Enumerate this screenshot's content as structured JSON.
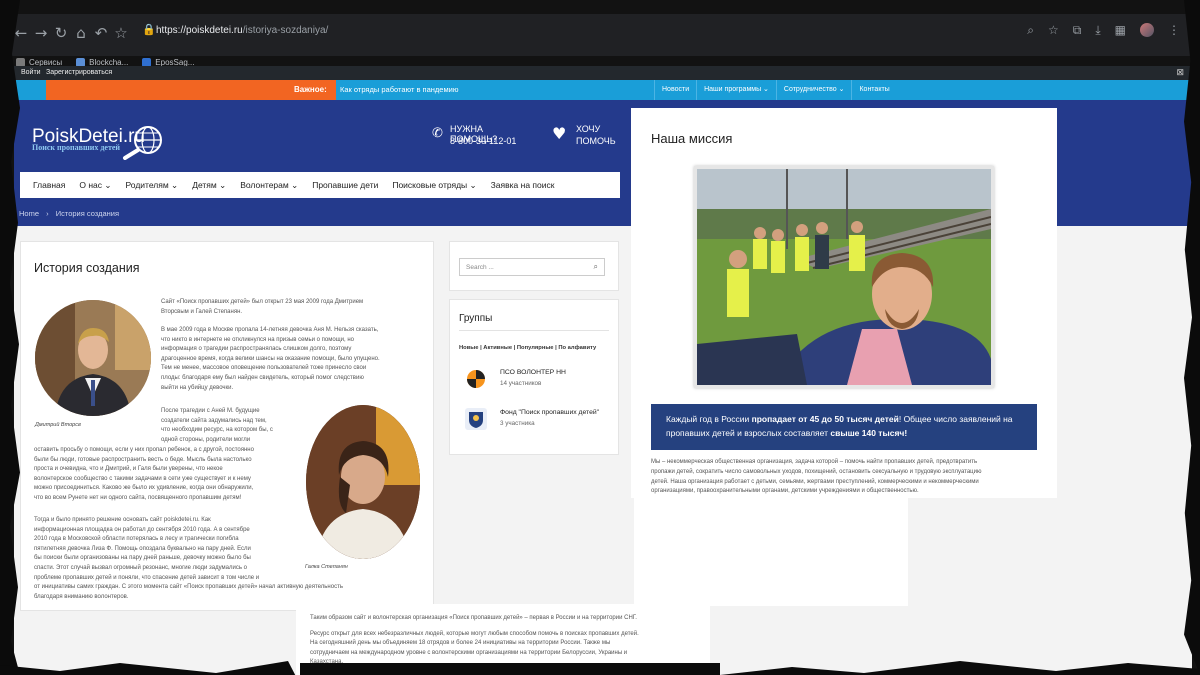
{
  "browser": {
    "url_host": "https://poiskdetei.ru",
    "url_path": "/istoriya-sozdaniya/",
    "bookmarks": [
      "Сервисы",
      "Blockcha...",
      "EposSag..."
    ]
  },
  "wpbar": {
    "login": "Войти",
    "register": "Зарегистрироваться"
  },
  "topstrip": {
    "important_label": "Важное:",
    "ticker": "Как отряды работают в пандемию",
    "menu": [
      "Новости",
      "Наши программы ⌄",
      "Сотрудничество ⌄",
      "Контакты"
    ]
  },
  "header": {
    "logo_text": "PoiskDetei.ru",
    "logo_sub": "Поиск пропавших детей",
    "help_title": "НУЖНА ПОМОЩЬ?",
    "help_phone": "8-800-30-112-01",
    "want_line1": "ХОЧУ",
    "want_line2": "ПОМОЧЬ",
    "main_menu": [
      "Главная",
      "О нас ⌄",
      "Родителям ⌄",
      "Детям ⌄",
      "Волонтерам ⌄",
      "Пропавшие дети",
      "Поисковые отряды ⌄",
      "Заявка на поиск"
    ],
    "breadcrumb_home": "Home",
    "breadcrumb_sep": "›",
    "breadcrumb_current": "История создания"
  },
  "article": {
    "title": "История создания",
    "caption1": "Дмитрий Вторсв",
    "caption2": "Галка Степанян",
    "p1_lines": [
      "Сайт «Поиск пропавших детей» был открыт 23 мая 2009 года Дмитрием",
      "Вторсвым и Галей Степанян."
    ],
    "p2_lines": [
      "В мае 2009 года в Москве пропала 14-летняя девочка Аня М. Нельзя сказать,",
      "что никто в интернете не откликнулся на призыв семьи о помощи, но",
      "информация о трагедии распространялась слишком долго, поэтому",
      "драгоценное время, когда велики шансы на оказание помощи, было упущено.",
      "Тем не менее, массовое оповещение пользователей тоже принесло свои",
      "плоды: благодаря ему был найден свидетель, который помог следствию",
      "выйти на убийцу девочки."
    ],
    "p3_lines": [
      "После трагедии с Аней М. будущие",
      "создатели сайта задумались над тем,",
      "что необходим ресурс, на котором бы, с",
      "одной стороны, родители могли"
    ],
    "p4_lines": [
      "оставить просьбу о помощи, если у них пропал ребенок, а с другой, постоянно",
      "были бы люди, готовые распространить весть о беде. Мысль была настолько",
      "проста и очевидна, что и Дмитрий, и Галя были уверены, что некое",
      "волонтерское сообщество с такими задачами в сети уже существует и к нему",
      "можно присоединиться. Каково же было их удивление, когда они обнаружили,",
      "что во всем Рунете нет ни одного сайта, посвященного пропавшим детям!"
    ],
    "p5_lines": [
      "Тогда и было принято решение основать сайт poiskdetei.ru. Как",
      "информационная площадка он работал до сентября 2010 года. А в сентябре",
      "2010 года в Московской области потерялась в лесу и трагически погибла",
      "пятилетняя девочка Лиза Ф. Помощь опоздала буквально на пару дней. Если",
      "бы поиски были организованы на пару дней раньше, девочку можно было бы",
      "спасти. Этот случай вызвал огромный резонанс, многие люди задумались о",
      "проблеме пропавших детей и поняли, что спасение детей зависит в том числе и",
      "от инициативы самих граждан. С этого момента сайт «Поиск пропавших детей» начал активную деятельность",
      "благодаря вниманию волонтеров."
    ]
  },
  "lower": {
    "lines": [
      "Таким образом сайт и волонтерская организация «Поиск пропавших детей» – первая в России и на территории СНГ.",
      "",
      "Ресурс открыт для всех небезразличных людей, которые могут любым способом помочь в поисках пропавших детей.",
      "На сегодняшний день мы объединяем 18 отрядов и более 24 инициативы на территории России. Также мы",
      "сотрудничаем на международном уровне с волонтерскими организациями на территории Белоруссии, Украины и",
      "Казахстана."
    ]
  },
  "sidebar": {
    "search_placeholder": "Search ...",
    "groups_title": "Группы",
    "filters": "Новые | Активные | Популярные | По алфавиту",
    "groups": [
      {
        "name": "ПСО ВОЛОНТЕР НН",
        "count": "14 участников"
      },
      {
        "name": "Фонд \"Поиск пропавших детей\"",
        "count": "3 участника"
      }
    ]
  },
  "mission": {
    "title": "Наша миссия",
    "banner_pre": "Каждый год в России ",
    "banner_b1": "пропадает от 45 до 50 тысяч детей",
    "banner_mid": "! Общее число заявлений на пропавших детей и взрослых составляет ",
    "banner_b2": "свыше 140 тысяч!",
    "text_lines": [
      "Мы – некоммерческая общественная организация, задача которой – помочь найти пропавших детей, предотвратить",
      "пропажи детей, сократить число самовольных уходов, похищений, остановить сексуальную и трудовую эксплуатацию",
      "детей. Наша организация работает с детьми, семьями, жертвами преступлений, коммерческими и некоммерческими",
      "организациями, правоохранительными органами, детскими учреждениями и общественностью."
    ]
  },
  "colors": {
    "header_blue": "#243a8c",
    "strip_blue": "#1a9ed8",
    "accent_orange": "#f26522",
    "banner_blue": "#25417f"
  }
}
